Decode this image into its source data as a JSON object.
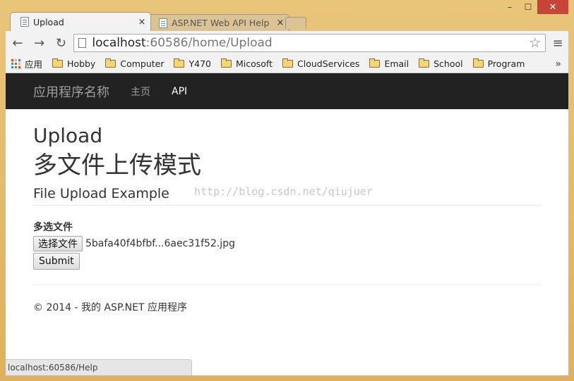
{
  "window": {
    "controls": {
      "minimize": "–",
      "maximize": "☐",
      "close": "✕"
    }
  },
  "tabs": [
    {
      "label": "Upload",
      "active": true,
      "close": "×"
    },
    {
      "label": "ASP.NET Web API Help",
      "active": false,
      "close": "×"
    }
  ],
  "toolbar": {
    "back": "←",
    "forward": "→",
    "reload": "↻",
    "url_host": "localhost",
    "url_path": ":60586/home/Upload",
    "star": "☆",
    "menu": "≡"
  },
  "bookmarks": {
    "apps_label": "应用",
    "folders": [
      "Hobby",
      "Computer",
      "Y470",
      "Micosoft",
      "CloudServices",
      "Email",
      "School",
      "Program"
    ],
    "overflow": "»",
    "apps_colors": [
      "#e8453c",
      "#f9bb2d",
      "#3a7cef",
      "#35a852",
      "#e8453c",
      "#f9bb2d",
      "#3a7cef",
      "#35a852",
      "#e8453c"
    ]
  },
  "navbar": {
    "brand": "应用程序名称",
    "links": [
      {
        "label": "主页",
        "active": false
      },
      {
        "label": "API",
        "active": true
      }
    ]
  },
  "page": {
    "title": "Upload",
    "heading_cn": "多文件上传模式",
    "watermark": "http://blog.csdn.net/qiujuer",
    "subheading": "File Upload Example",
    "field_label": "多选文件",
    "file_button": "选择文件",
    "file_name": "5bafa40f4bfbf...6aec31f52.jpg",
    "submit": "Submit",
    "footer": "© 2014 - 我的 ASP.NET 应用程序"
  },
  "status": "localhost:60586/Help"
}
